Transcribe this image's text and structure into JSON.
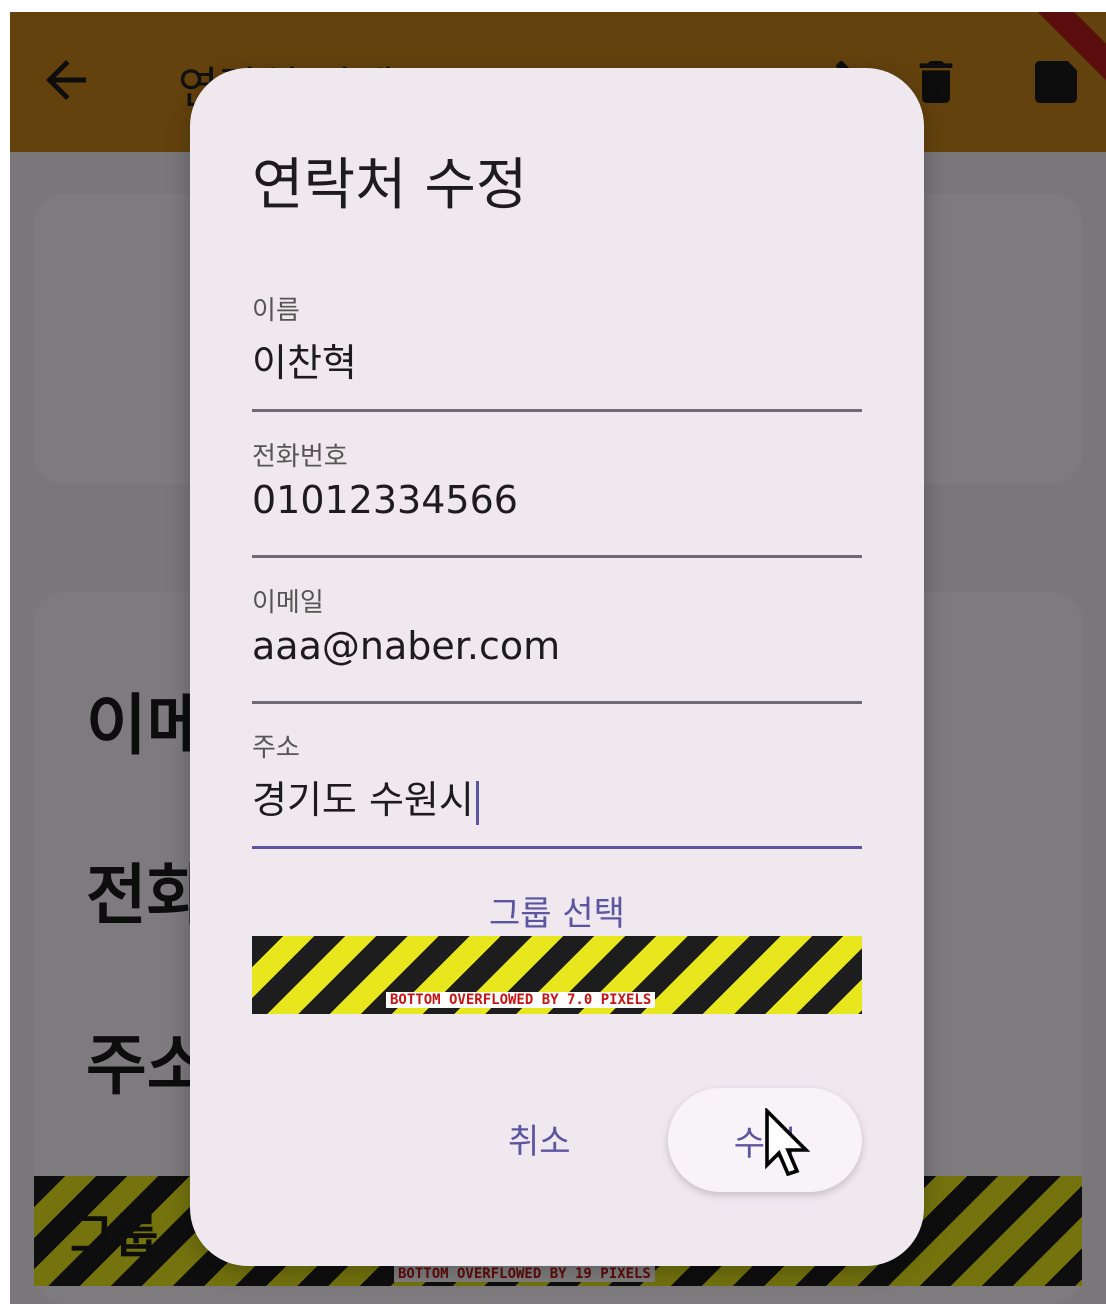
{
  "appbar": {
    "title": "연락처 상세",
    "back_icon": "arrow-left-icon",
    "actions": [
      "edit-icon",
      "trash-icon",
      "save-icon"
    ],
    "color": "#c9851a"
  },
  "background": {
    "labels": [
      "이메",
      "전화",
      "주소"
    ],
    "group_button": "그룹",
    "overflow_text": "BOTTOM OVERFLOWED BY 19 PIXELS"
  },
  "dialog": {
    "title": "연락처 수정",
    "fields": {
      "name": {
        "label": "이름",
        "value": "이찬혁"
      },
      "phone": {
        "label": "전화번호",
        "value": "01012334566"
      },
      "email": {
        "label": "이메일",
        "value": "aaa@naber.com"
      },
      "address": {
        "label": "주소",
        "value": "경기도 수원시"
      }
    },
    "group_select": "그룹 선택",
    "overflow_text": "BOTTOM OVERFLOWED BY 7.0 PIXELS",
    "cancel_label": "취소",
    "confirm_label": "수정",
    "accent_color": "#5c55a0"
  }
}
